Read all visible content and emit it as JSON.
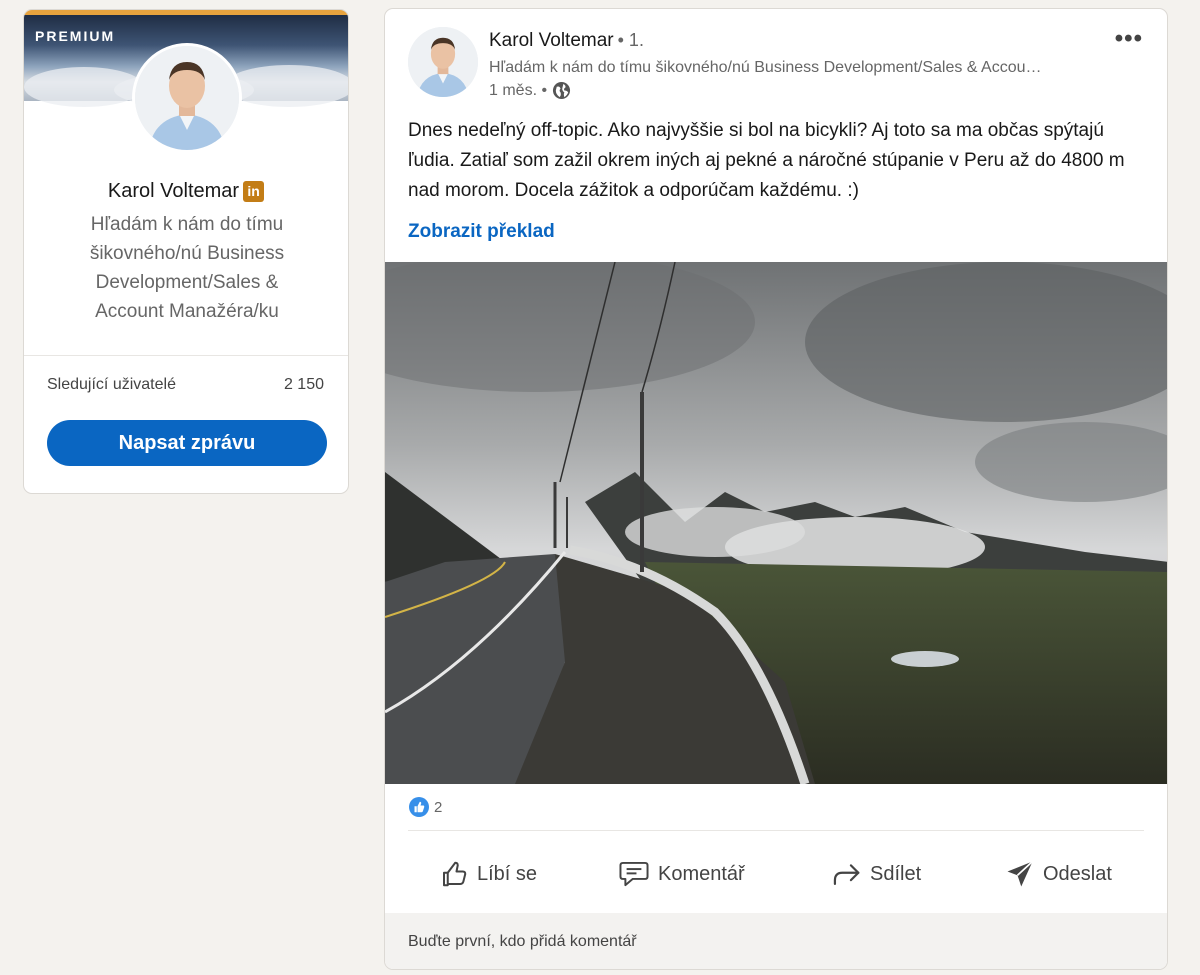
{
  "profile": {
    "premium_label": "PREMIUM",
    "name": "Karol Voltemar",
    "badge": "in",
    "headline": "Hľadám k nám do tímu šikovného/nú Business Development/Sales & Account Manažéra/ku",
    "followers_label": "Sledující uživatelé",
    "followers_count": "2 150",
    "message_button": "Napsat zprávu"
  },
  "post": {
    "author": "Karol Voltemar",
    "degree": "• 1.",
    "author_headline": "Hľadám k nám do tímu šikovného/nú Business Development/Sales & Accou…",
    "time": "1 měs. •",
    "visibility_icon": "globe-icon",
    "text": "Dnes nedeľný off-topic. Ako najvyššie si bol na bicykli? Aj toto sa ma občas spýtajú ľudia. Zatiaľ som zažil okrem iných aj pekné a náročné stúpanie v Peru až do 4800 m nad morom. Docela zážitok a odporúčam každému. :)",
    "translate_link": "Zobrazit překlad",
    "reaction_count": "2",
    "actions": {
      "like": "Líbí se",
      "comment": "Komentář",
      "share": "Sdílet",
      "send": "Odeslat"
    },
    "comment_prompt": "Buďte první, kdo přidá komentář"
  },
  "colors": {
    "accent": "#0a66c2",
    "premium_gold": "#e7a33e",
    "background": "#f4f2ee"
  }
}
